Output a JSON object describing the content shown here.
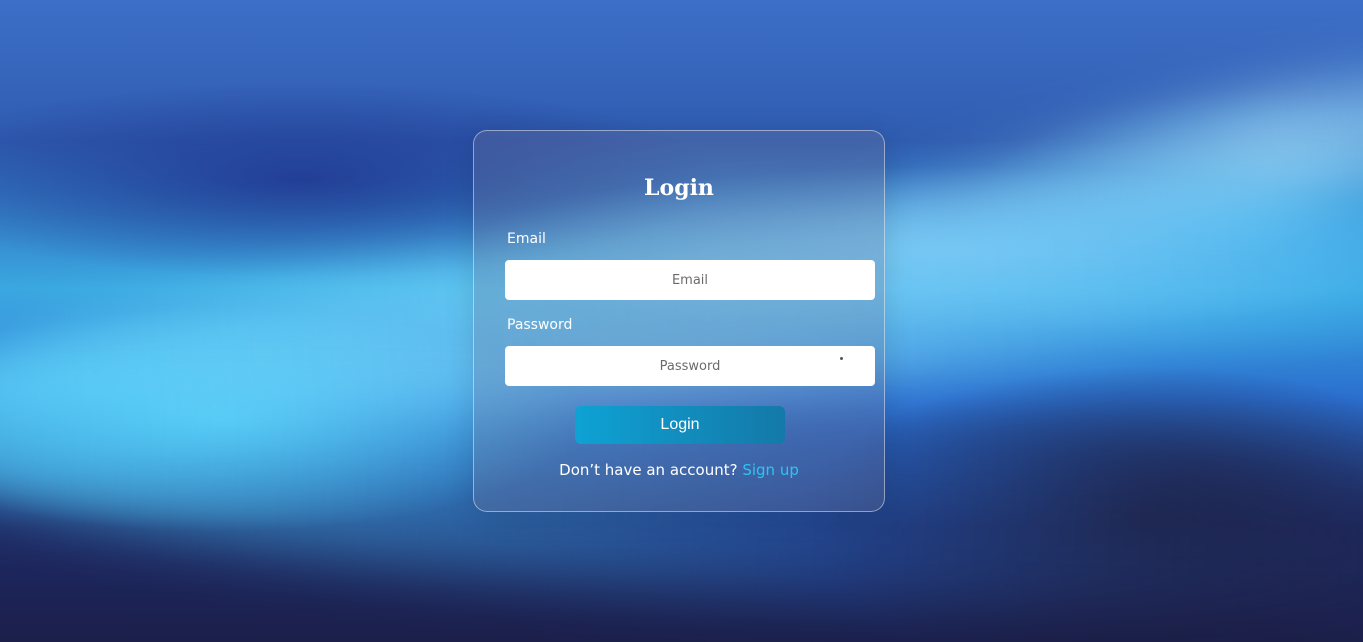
{
  "login": {
    "title": "Login",
    "email_label": "Email",
    "email_placeholder": "Email",
    "password_label": "Password",
    "password_placeholder": "Password",
    "submit_label": "Login",
    "signup_prompt": "Don’t have an account?",
    "signup_link": "Sign up"
  },
  "colors": {
    "accent": "#0ea2d4",
    "link": "#2ec4f0"
  }
}
